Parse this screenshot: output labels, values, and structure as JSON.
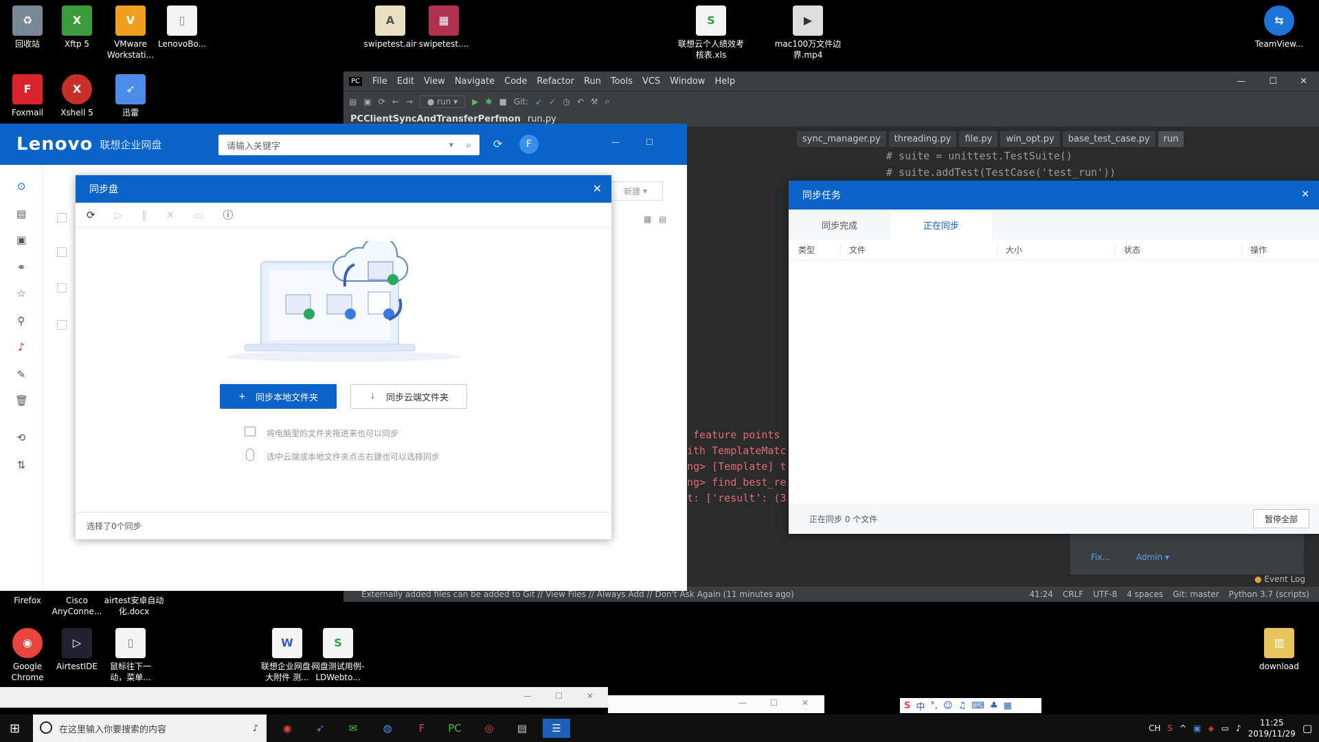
{
  "desktop": {
    "top_icons": [
      {
        "label": "回收站",
        "icon": "recycle-bin-icon"
      },
      {
        "label": "Xftp 5",
        "icon": "xftp-icon"
      },
      {
        "label": "VMware Workstati...",
        "icon": "vmware-icon"
      },
      {
        "label": "LenovoBo...",
        "icon": "file-icon"
      },
      {
        "label": "swipetest.air",
        "icon": "air-file-icon"
      },
      {
        "label": "swipetest....",
        "icon": "archive-icon"
      },
      {
        "label": "联想云个人绩效考核表.xls",
        "icon": "excel-icon"
      },
      {
        "label": "mac100万文件边界.mp4",
        "icon": "video-icon"
      },
      {
        "label": "TeamView...",
        "icon": "teamviewer-icon"
      },
      {
        "label": "Foxmail",
        "icon": "foxmail-icon"
      },
      {
        "label": "Xshell 5",
        "icon": "xshell-icon"
      },
      {
        "label": "迅雷",
        "icon": "thunder-icon"
      }
    ],
    "bottom_icons": [
      {
        "label": "Firefox"
      },
      {
        "label": "Cisco AnyConne..."
      },
      {
        "label": "airtest安卓自动化.docx"
      },
      {
        "label": "Google Chrome"
      },
      {
        "label": "AirtestIDE"
      },
      {
        "label": "鼠标往下一动，菜单..."
      },
      {
        "label": "联想企业网盘-大附件 测..."
      },
      {
        "label": "网盘测试用例-LDWebto..."
      },
      {
        "label": "download"
      }
    ]
  },
  "ide": {
    "menu": [
      "File",
      "Edit",
      "View",
      "Navigate",
      "Code",
      "Refactor",
      "Run",
      "Tools",
      "VCS",
      "Window",
      "Help"
    ],
    "run_config": "run",
    "git_label": "Git:",
    "project": "PCClientSyncAndTransferPerfmon",
    "breadcrumb_file": "run.py",
    "tabs": [
      "sync_manager.py",
      "threading.py",
      "file.py",
      "win_opt.py",
      "base_test_case.py",
      "run"
    ],
    "code_lines": [
      "# suite = unittest.TestSuite()",
      "# suite.addTest(TestCase('test_run'))"
    ],
    "console_lines": [
      " feature points",
      "ith TemplateMatc",
      "ng> [Template] t",
      "ng> find_best_re",
      "t: ['result': (3"
    ],
    "status_message": "Externally added files can be added to Git // View Files // Always Add // Don't Ask Again (11 minutes ago)",
    "status_right": [
      "41:24",
      "CRLF",
      "UTF-8",
      "4 spaces",
      "Git: master",
      "Python 3.7 (scripts)"
    ],
    "event_log": "Event Log",
    "side_links": [
      "Fix...",
      "Admin ▾"
    ]
  },
  "lenovo": {
    "logo": "Lenovo",
    "subtitle": "联想企业网盘",
    "search_placeholder": "请输入关键字",
    "avatar_letter": "F",
    "sort_label": "新建"
  },
  "sync_dialog": {
    "title": "同步盘",
    "btn_local": "同步本地文件夹",
    "btn_cloud": "同步云端文件夹",
    "hint1": "将电脑里的文件夹拖进来也可以同步",
    "hint2": "选中云端或本地文件夹点击右键也可以选择同步",
    "footer": "选择了0个同步"
  },
  "progress_dialog": {
    "title": "同步任务",
    "tab_done": "同步完成",
    "tab_active": "正在同步",
    "columns": [
      "类型",
      "文件",
      "大小",
      "状态",
      "操作"
    ],
    "footer_text": "正在同步 0 个文件",
    "pause_all": "暂停全部"
  },
  "taskbar": {
    "search_placeholder": "在这里输入你要搜索的内容",
    "time": "11:25",
    "date": "2019/11/29",
    "lang": "CH",
    "ime_label": "中"
  },
  "colors": {
    "lenovo_blue": "#0a64c8",
    "ide_bg": "#2b2b2b"
  }
}
